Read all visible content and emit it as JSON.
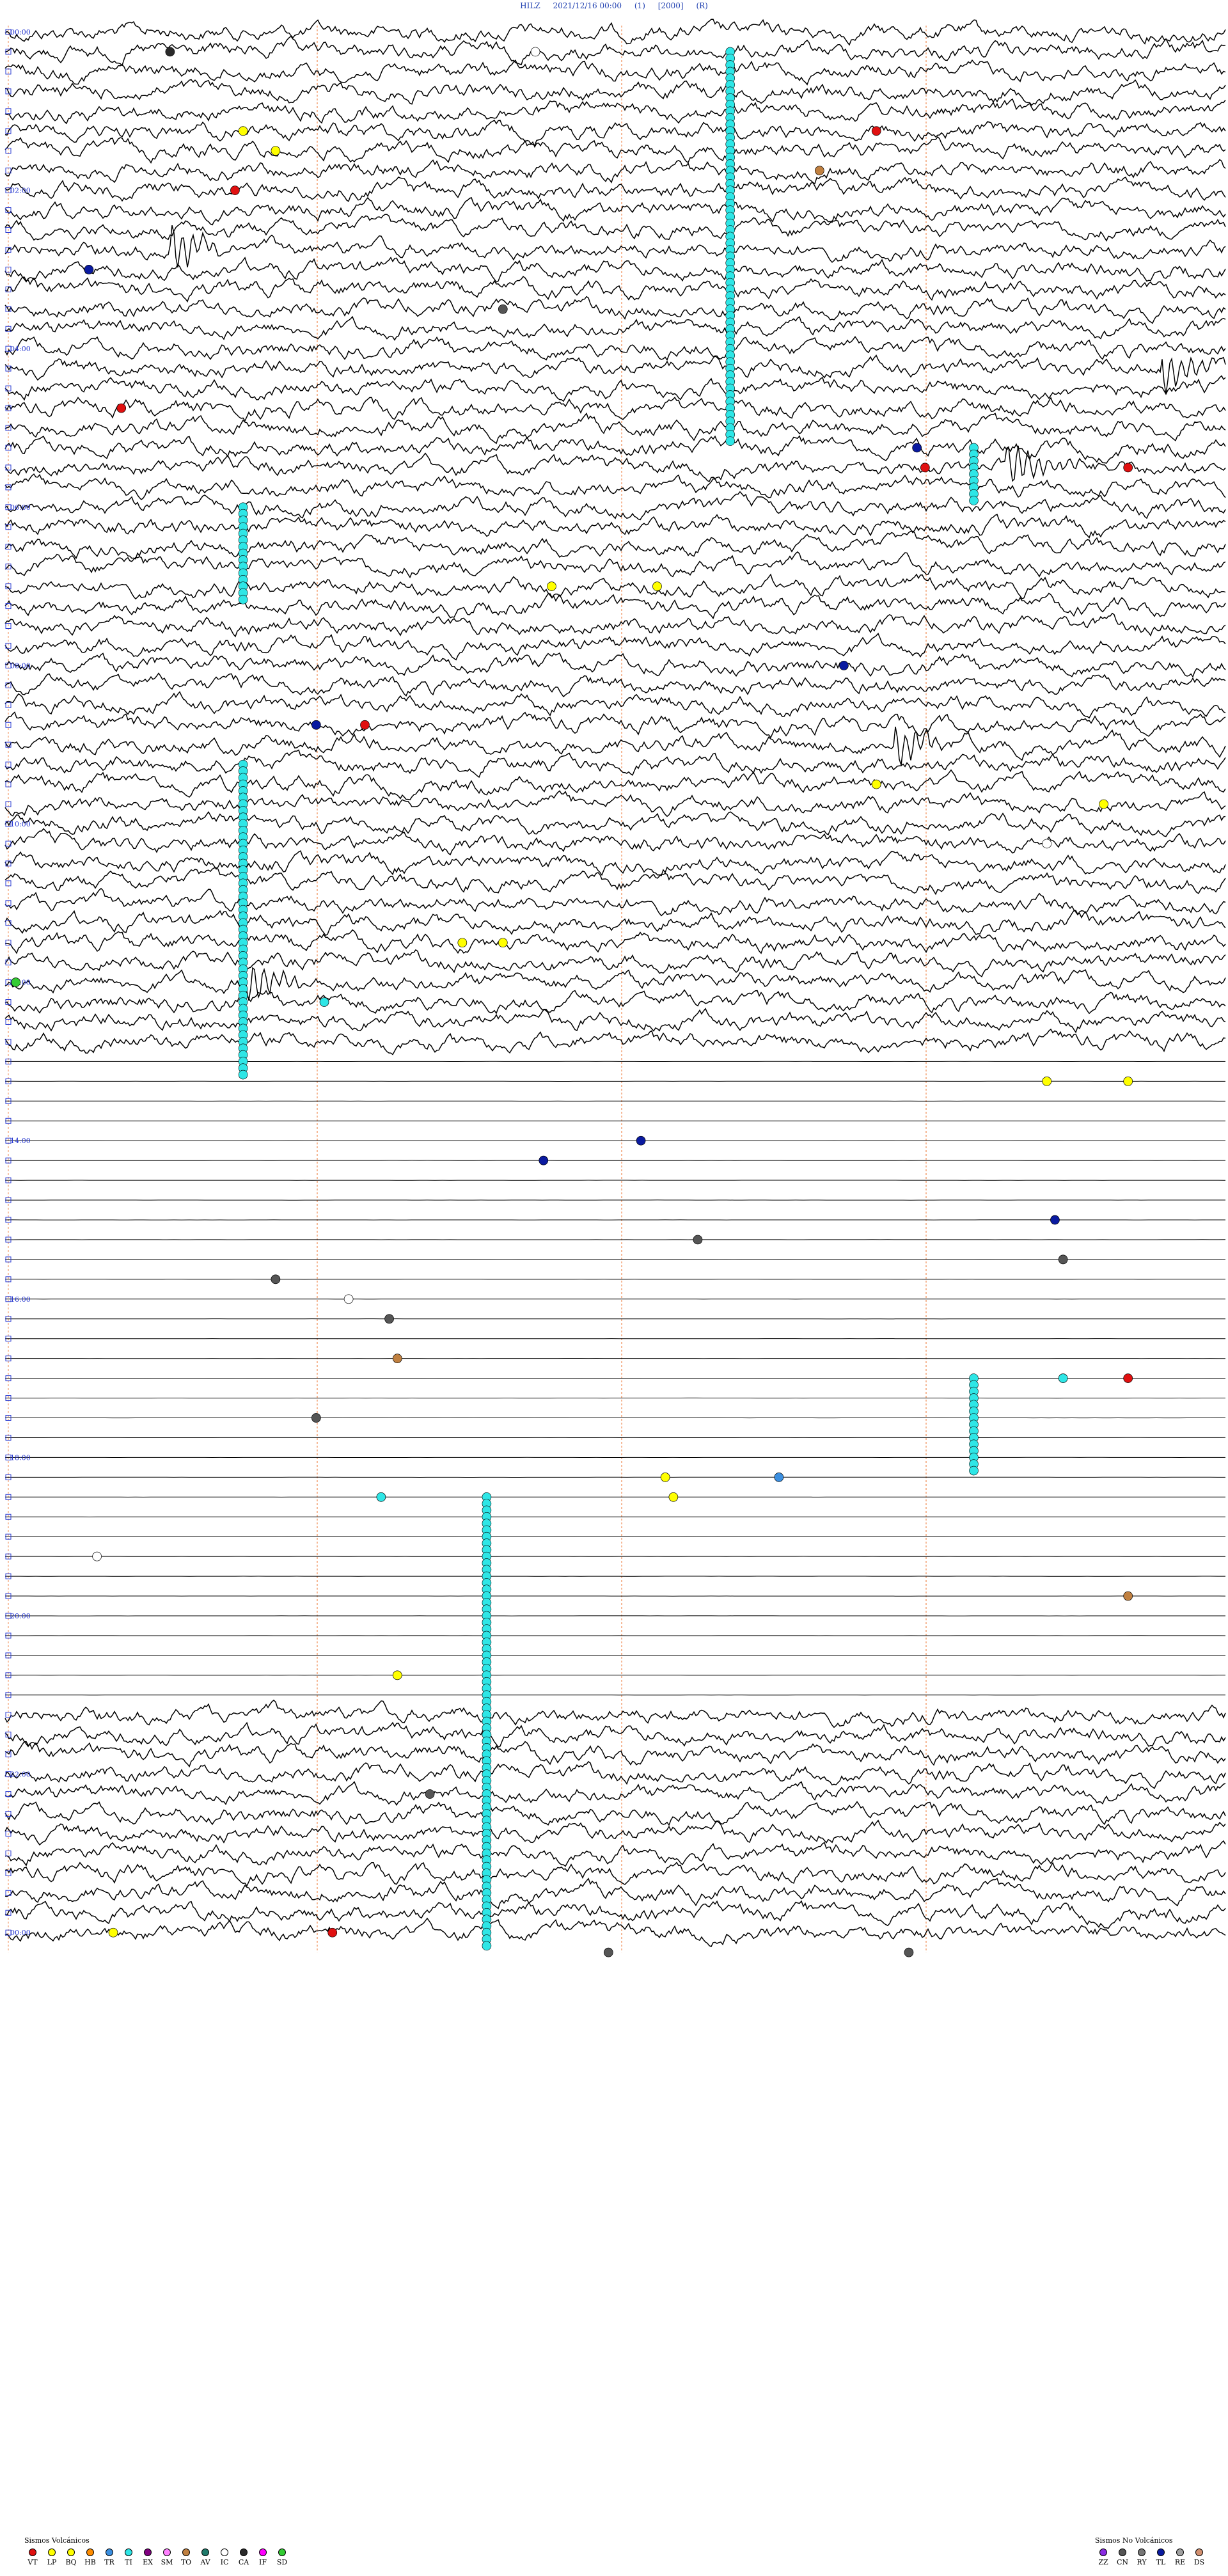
{
  "header": {
    "station": "HILZ",
    "datetime": "2021/12/16 00:00",
    "param1": "(1)",
    "param2": "[2000]",
    "param3": "(R)"
  },
  "hour_labels": [
    "00:00",
    "02:00",
    "04:00",
    "06:00",
    "08:00",
    "10:00",
    "12:00",
    "14:00",
    "16:00",
    "18:00",
    "20:00",
    "22:00",
    "00:00"
  ],
  "legend_volcanic": {
    "title": "Sismos Volcánicos",
    "items": [
      {
        "code": "VT",
        "color": "#e01010"
      },
      {
        "code": "LP",
        "color": "#ffff00"
      },
      {
        "code": "BQ",
        "color": "#ffff00"
      },
      {
        "code": "HB",
        "color": "#ff8c00"
      },
      {
        "code": "TR",
        "color": "#3b8fe0"
      },
      {
        "code": "TI",
        "color": "#2ee6e6"
      },
      {
        "code": "EX",
        "color": "#800080"
      },
      {
        "code": "SM",
        "color": "#ff80ff"
      },
      {
        "code": "TO",
        "color": "#c08040"
      },
      {
        "code": "AV",
        "color": "#1f7a6b"
      },
      {
        "code": "IC",
        "color": "#ffffff"
      },
      {
        "code": "CA",
        "color": "#2a2a2a"
      },
      {
        "code": "IF",
        "color": "#ff00ff"
      },
      {
        "code": "SD",
        "color": "#33cc33"
      }
    ]
  },
  "legend_nonvolcanic": {
    "title": "Sismos No Volcánicos",
    "items": [
      {
        "code": "ZZ",
        "color": "#8a2be2"
      },
      {
        "code": "CN",
        "color": "#555555"
      },
      {
        "code": "RY",
        "color": "#777777"
      },
      {
        "code": "TL",
        "color": "#0a1aa0"
      },
      {
        "code": "RE",
        "color": "#a0a0a0"
      },
      {
        "code": "DS",
        "color": "#d29070"
      }
    ]
  },
  "chart_data": {
    "type": "line",
    "description_kind": "helicorder",
    "rows_total": 96,
    "minutes_per_row": 15,
    "x_minutes": [
      0,
      15
    ],
    "segments": [
      {
        "from_row": 0,
        "to_row": 51,
        "activity": "high"
      },
      {
        "from_row": 52,
        "to_row": 84,
        "activity": "low"
      },
      {
        "from_row": 85,
        "to_row": 96,
        "activity": "high"
      }
    ],
    "events": [
      {
        "row": 1,
        "minute": 2.0,
        "type": "CA"
      },
      {
        "row": 1,
        "minute": 6.5,
        "type": "IC"
      },
      {
        "row": 5,
        "minute": 2.9,
        "type": "LP"
      },
      {
        "row": 5,
        "minute": 10.7,
        "type": "VT"
      },
      {
        "row": 6,
        "minute": 3.3,
        "type": "LP"
      },
      {
        "row": 7,
        "minute": 10.0,
        "type": "TO"
      },
      {
        "row": 8,
        "minute": 2.8,
        "type": "VT"
      },
      {
        "row": 12,
        "minute": 1.0,
        "type": "TL"
      },
      {
        "row": 14,
        "minute": 6.1,
        "type": "CN"
      },
      {
        "row": 19,
        "minute": 1.4,
        "type": "VT"
      },
      {
        "row": 21,
        "minute": 11.2,
        "type": "TL"
      },
      {
        "row": 22,
        "minute": 11.3,
        "type": "VT"
      },
      {
        "row": 22,
        "minute": 13.8,
        "type": "VT"
      },
      {
        "row": 28,
        "minute": 6.7,
        "type": "LP"
      },
      {
        "row": 28,
        "minute": 8.0,
        "type": "LP"
      },
      {
        "row": 32,
        "minute": 10.3,
        "type": "TL"
      },
      {
        "row": 35,
        "minute": 3.8,
        "type": "TL"
      },
      {
        "row": 35,
        "minute": 4.4,
        "type": "VT"
      },
      {
        "row": 38,
        "minute": 10.7,
        "type": "LP"
      },
      {
        "row": 39,
        "minute": 13.5,
        "type": "LP"
      },
      {
        "row": 41,
        "minute": 12.8,
        "type": "IC"
      },
      {
        "row": 46,
        "minute": 5.6,
        "type": "LP"
      },
      {
        "row": 46,
        "minute": 6.1,
        "type": "LP"
      },
      {
        "row": 48,
        "minute": 0.1,
        "type": "SD"
      },
      {
        "row": 49,
        "minute": 3.9,
        "type": "TI"
      },
      {
        "row": 53,
        "minute": 12.8,
        "type": "LP"
      },
      {
        "row": 53,
        "minute": 13.8,
        "type": "LP"
      },
      {
        "row": 56,
        "minute": 7.8,
        "type": "TL"
      },
      {
        "row": 57,
        "minute": 6.6,
        "type": "TL"
      },
      {
        "row": 60,
        "minute": 12.9,
        "type": "TL"
      },
      {
        "row": 61,
        "minute": 8.5,
        "type": "CN"
      },
      {
        "row": 62,
        "minute": 13.0,
        "type": "CN"
      },
      {
        "row": 63,
        "minute": 3.3,
        "type": "CN"
      },
      {
        "row": 64,
        "minute": 4.2,
        "type": "IC"
      },
      {
        "row": 65,
        "minute": 4.7,
        "type": "CN"
      },
      {
        "row": 67,
        "minute": 4.8,
        "type": "TO"
      },
      {
        "row": 68,
        "minute": 13.0,
        "type": "TI"
      },
      {
        "row": 68,
        "minute": 13.8,
        "type": "VT"
      },
      {
        "row": 70,
        "minute": 3.8,
        "type": "CN"
      },
      {
        "row": 73,
        "minute": 8.1,
        "type": "LP"
      },
      {
        "row": 73,
        "minute": 9.5,
        "type": "TR"
      },
      {
        "row": 74,
        "minute": 4.6,
        "type": "TI"
      },
      {
        "row": 74,
        "minute": 8.2,
        "type": "LP"
      },
      {
        "row": 77,
        "minute": 1.1,
        "type": "IC"
      },
      {
        "row": 79,
        "minute": 13.8,
        "type": "TO"
      },
      {
        "row": 83,
        "minute": 4.8,
        "type": "LP"
      },
      {
        "row": 89,
        "minute": 5.2,
        "type": "CN"
      },
      {
        "row": 96,
        "minute": 1.3,
        "type": "LP"
      },
      {
        "row": 96,
        "minute": 4.0,
        "type": "VT"
      },
      {
        "row": 97,
        "minute": 7.4,
        "type": "CN"
      },
      {
        "row": 97,
        "minute": 11.1,
        "type": "CN"
      }
    ],
    "ti_columns": [
      {
        "minute": 8.9,
        "from_row": 1,
        "to_row": 20
      },
      {
        "minute": 2.9,
        "from_row": 24,
        "to_row": 28
      },
      {
        "minute": 11.9,
        "from_row": 21,
        "to_row": 23
      },
      {
        "minute": 2.9,
        "from_row": 37,
        "to_row": 52
      },
      {
        "minute": 5.9,
        "from_row": 74,
        "to_row": 96
      },
      {
        "minute": 11.9,
        "from_row": 68,
        "to_row": 72
      }
    ],
    "bursts": [
      {
        "row": 11,
        "minute": 2.0
      },
      {
        "row": 17,
        "minute": 14.2
      },
      {
        "row": 22,
        "minute": 12.3
      },
      {
        "row": 36,
        "minute": 10.9
      },
      {
        "row": 48,
        "minute": 2.9
      }
    ]
  }
}
